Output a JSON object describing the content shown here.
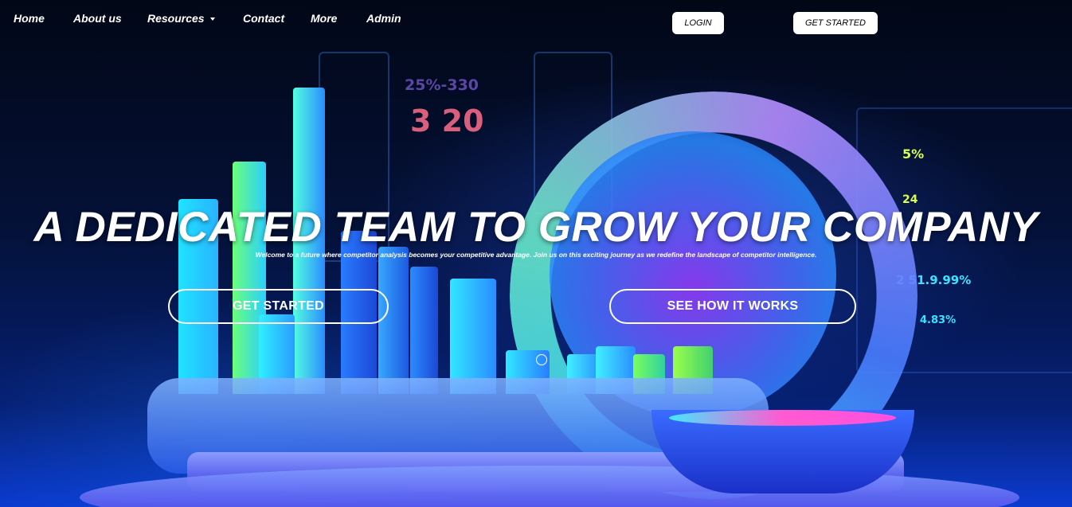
{
  "nav": {
    "items": [
      {
        "label": "Home"
      },
      {
        "label": "About us"
      },
      {
        "label": "Resources",
        "dropdown": true
      },
      {
        "label": "Contact"
      },
      {
        "label": "More"
      },
      {
        "label": "Admin"
      }
    ],
    "login_label": "LOGIN",
    "get_started_label": "GET STARTED"
  },
  "hero": {
    "title": "A DEDICATED TEAM TO GROW YOUR COMPANY",
    "subtitle": "Welcome to a future where competitor analysis becomes your competitive advantage. Join us on this exciting journey as we redefine the landscape of competitor intelligence.",
    "primary_cta": "GET STARTED",
    "secondary_cta": "SEE HOW IT WORKS"
  },
  "background_numbers": [
    "25%-330",
    "3 20",
    "5%",
    "24",
    "2 51.9.99%",
    "4.83%"
  ],
  "colors": {
    "nav_text": "#ffffff",
    "button_bg": "#ffffff",
    "accent_cyan": "#2fd6ff",
    "accent_purple": "#b58cff"
  },
  "icons": [
    "caret-down-icon",
    "carousel-dot-icon"
  ]
}
